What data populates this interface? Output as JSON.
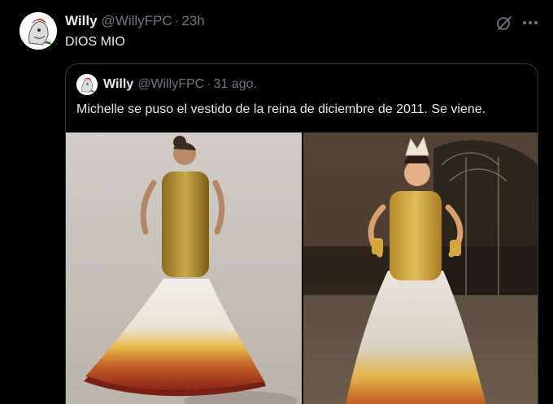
{
  "tweet": {
    "author_name": "Willy",
    "author_handle": "@WillyFPC",
    "separator": "·",
    "timestamp": "23h",
    "text": "DIOS MIO"
  },
  "quote": {
    "author_name": "Willy",
    "author_handle": "@WillyFPC",
    "separator": "·",
    "timestamp": "31 ago.",
    "text": "Michelle se puso el vestido de la reina de diciembre de 2011. Se viene."
  },
  "icons": {
    "avatar": "avatar-illustration",
    "grok": "grok-icon",
    "more": "more-options-icon"
  },
  "colors": {
    "background": "#000000",
    "primary_text": "#e7e9ea",
    "secondary_text": "#71767b",
    "border": "#2f3336"
  }
}
